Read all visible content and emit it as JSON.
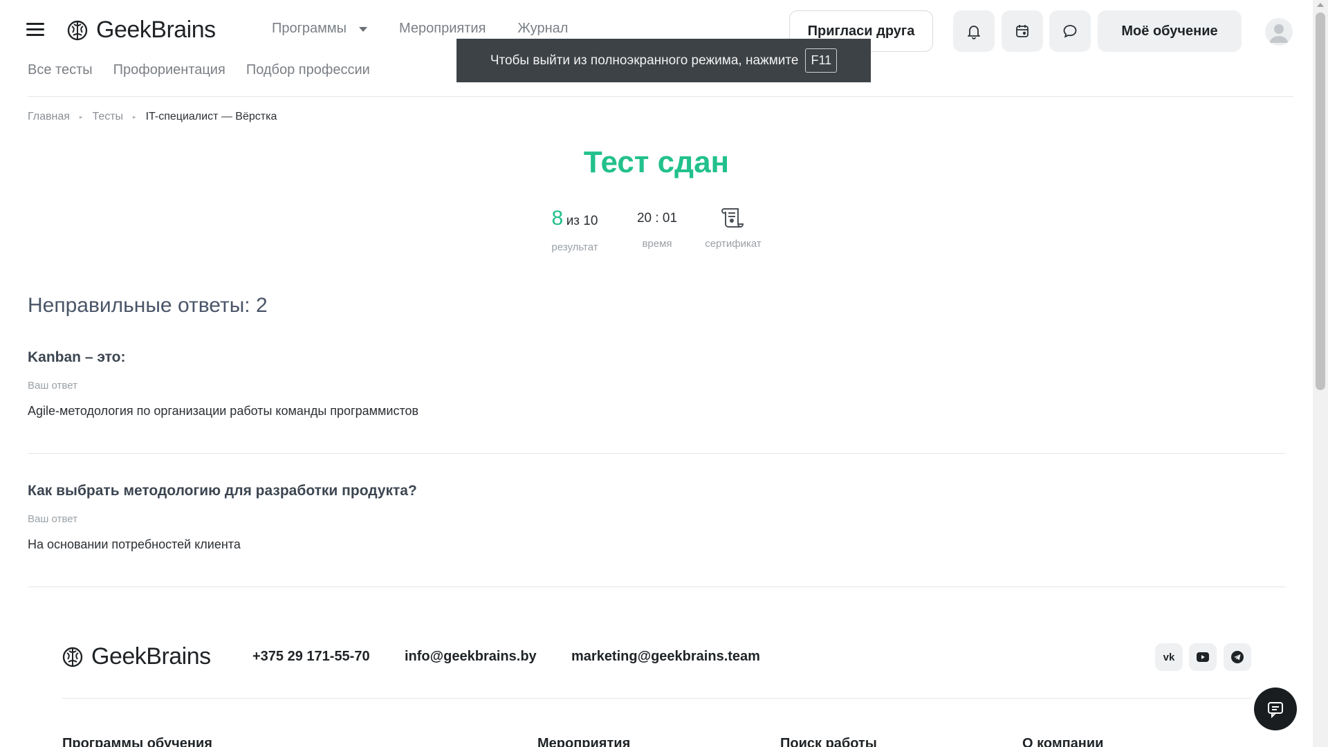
{
  "header": {
    "logo_text": "GeekBrains",
    "nav": [
      {
        "label": "Программы"
      },
      {
        "label": "Мероприятия"
      },
      {
        "label": "Журнал"
      }
    ],
    "subnav": [
      "Все тесты",
      "Профориентация",
      "Подбор профессии"
    ],
    "invite_label": "Пригласи друга",
    "learning_label": "Моё обучение",
    "icons": [
      "bell-icon",
      "calendar-icon",
      "chat-icon",
      "user-avatar-icon"
    ]
  },
  "toast": {
    "text": "Чтобы выйти из полноэкранного режима, нажмите",
    "key": "F11"
  },
  "breadcrumb": [
    "Главная",
    "Тесты",
    "IT-специалист — Вёрстка"
  ],
  "result": {
    "title": "Тест сдан",
    "score": "8",
    "score_total": "из 10",
    "score_label": "результат",
    "time": "20 : 01",
    "time_label": "время",
    "cert_label": "сертификат"
  },
  "wrong_answers": {
    "title": "Неправильные ответы: 2",
    "answer_label": "Ваш ответ",
    "items": [
      {
        "question": "Kanban – это:",
        "answer": "Agile-методология по организации работы команды программистов"
      },
      {
        "question": "Как выбрать методологию для разработки продукта?",
        "answer": "На основании потребностей клиента"
      }
    ]
  },
  "footer": {
    "logo_text": "GeekBrains",
    "phone": "+375 29 171-55-70",
    "email": "info@geekbrains.by",
    "marketing_email": "marketing@geekbrains.team",
    "social": [
      "vk-icon",
      "youtube-icon",
      "telegram-icon"
    ],
    "columns": [
      "Программы обучения",
      "Мероприятия",
      "Поиск работы",
      "О компании"
    ]
  },
  "colors": {
    "accent_green": "#22c08c",
    "toast_bg": "#3d4246",
    "button_bg": "#eef0f2"
  }
}
